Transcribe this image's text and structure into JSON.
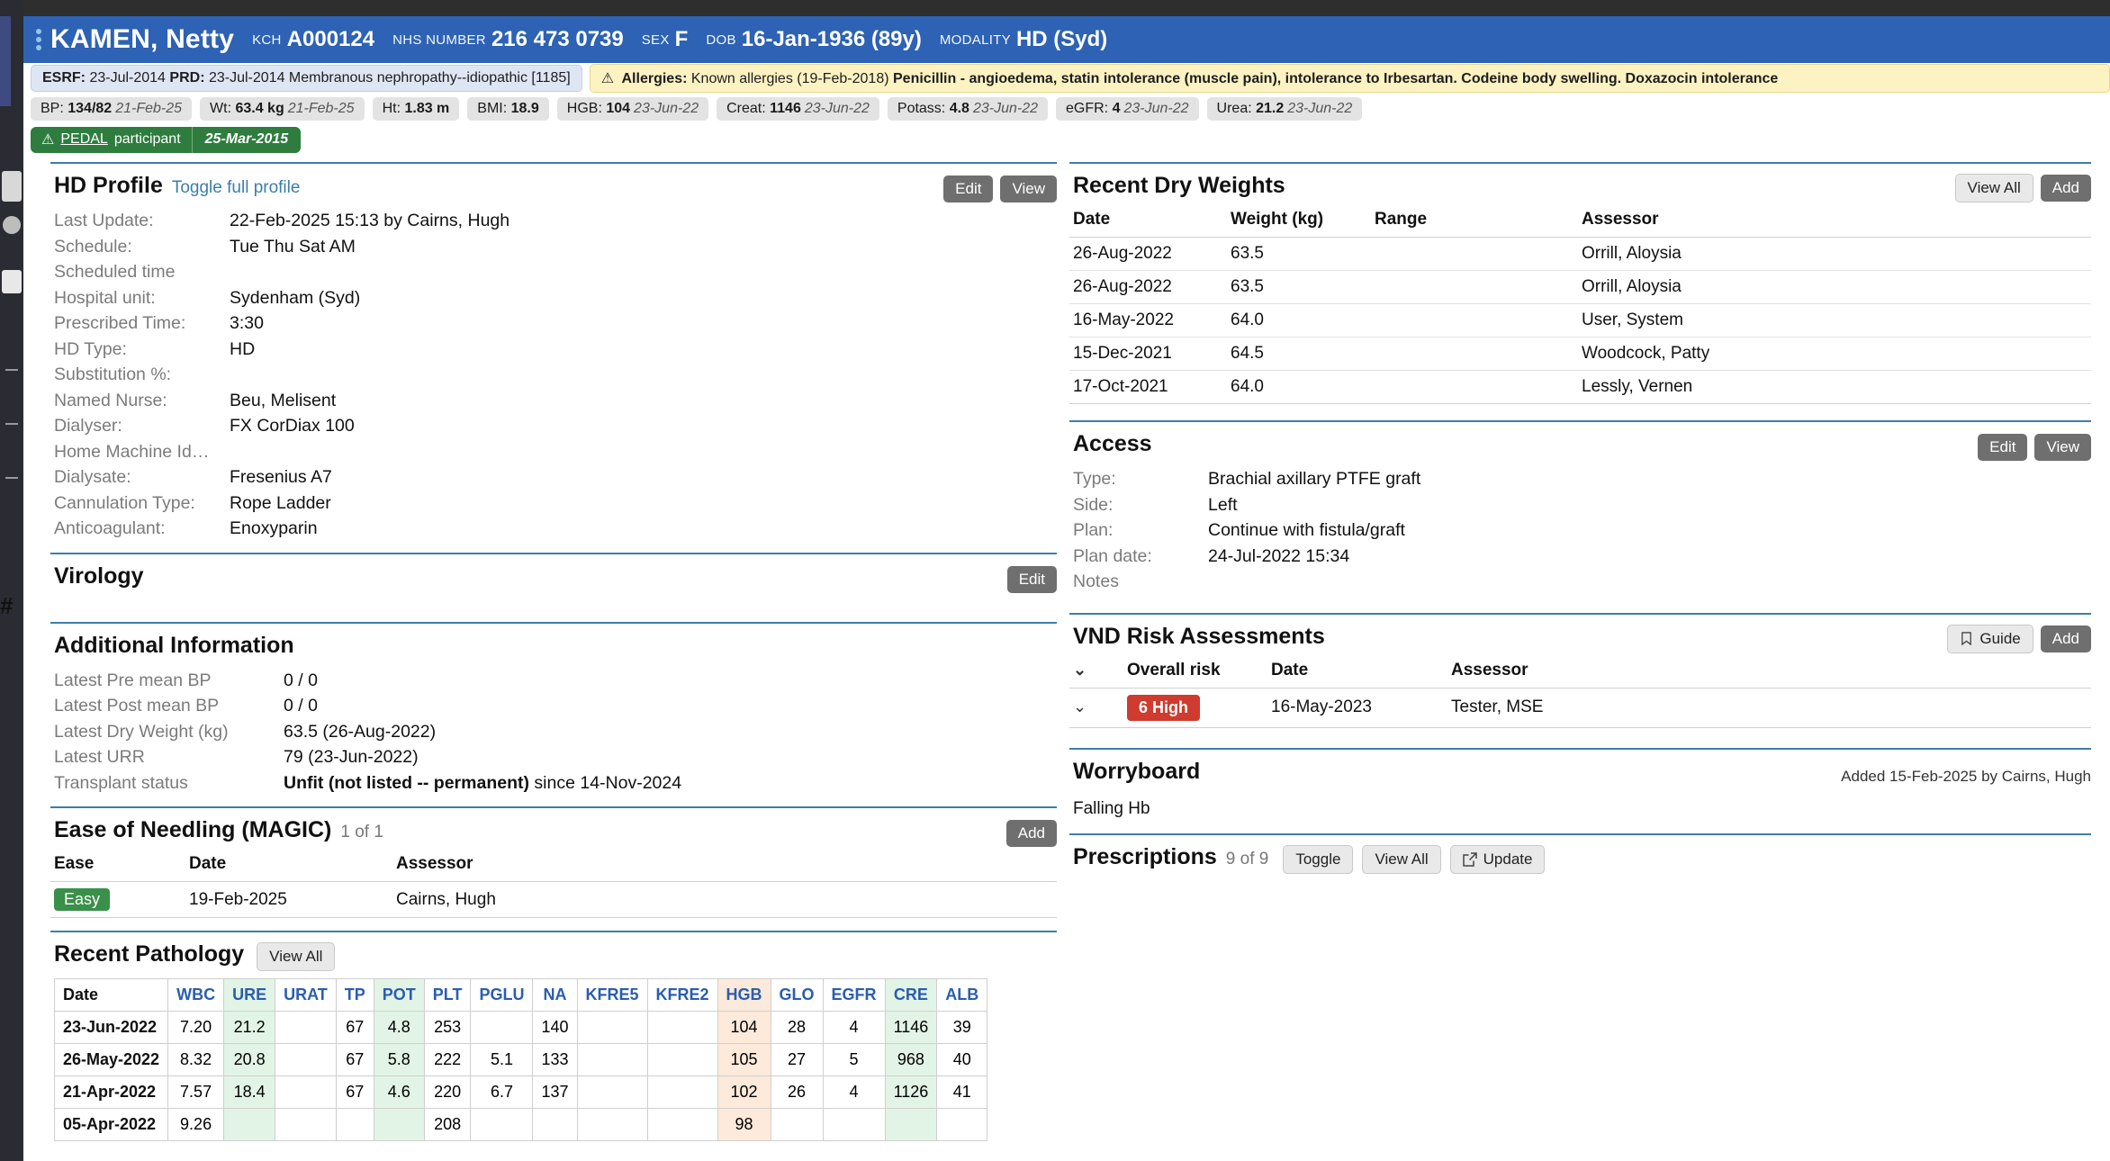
{
  "banner": {
    "patient_name": "KAMEN, Netty",
    "fields": [
      {
        "label": "KCH",
        "value": "A000124"
      },
      {
        "label": "NHS NUMBER",
        "value": "216 473 0739"
      },
      {
        "label": "SEX",
        "value": "F"
      },
      {
        "label": "DOB",
        "value": "16-Jan-1936 (89y)"
      },
      {
        "label": "MODALITY",
        "value": "HD (Syd)"
      }
    ]
  },
  "strips": {
    "esrf": "ESRF: 23-Jul-2014 PRD: 23-Jul-2014 Membranous nephropathy--idiopathic [1185]",
    "esrf_label1": "ESRF:",
    "esrf_val1": "23-Jul-2014",
    "esrf_label2": "PRD:",
    "esrf_val2": "23-Jul-2014 Membranous nephropathy--idiopathic [1185]",
    "allergies_label": "Allergies:",
    "allergies_known": "Known allergies (19-Feb-2018)",
    "allergies_detail": "Penicillin - angioedema, statin intolerance (muscle pain), intolerance to Irbesartan. Codeine body swelling. Doxazocin intolerance",
    "vitals": [
      {
        "key": "BP:",
        "value": "134/82",
        "date": "21-Feb-25"
      },
      {
        "key": "Wt:",
        "value": "63.4 kg",
        "date": "21-Feb-25"
      },
      {
        "key": "Ht:",
        "value": "1.83 m",
        "date": ""
      },
      {
        "key": "BMI:",
        "value": "18.9",
        "date": ""
      },
      {
        "key": "HGB:",
        "value": "104",
        "date": "23-Jun-22"
      },
      {
        "key": "Creat:",
        "value": "1146",
        "date": "23-Jun-22"
      },
      {
        "key": "Potass:",
        "value": "4.8",
        "date": "23-Jun-22"
      },
      {
        "key": "eGFR:",
        "value": "4",
        "date": "23-Jun-22"
      },
      {
        "key": "Urea:",
        "value": "21.2",
        "date": "23-Jun-22"
      }
    ],
    "pedal_label": "PEDAL",
    "pedal_word": "participant",
    "pedal_date": "25-Mar-2015"
  },
  "hd_profile": {
    "title": "HD Profile",
    "toggle_link": "Toggle full profile",
    "edit": "Edit",
    "view": "View",
    "rows": [
      {
        "key": "Last Update:",
        "value": "22-Feb-2025 15:13 by Cairns, Hugh"
      },
      {
        "key": "Schedule:",
        "value": "Tue Thu Sat AM"
      },
      {
        "key": "Scheduled time",
        "value": ""
      },
      {
        "key": "Hospital unit:",
        "value": "Sydenham (Syd)"
      },
      {
        "key": "Prescribed Time:",
        "value": "3:30"
      },
      {
        "key": "HD Type:",
        "value": "HD"
      },
      {
        "key": "Substitution %:",
        "value": ""
      },
      {
        "key": "Named Nurse:",
        "value": "Beu, Melisent"
      },
      {
        "key": "Dialyser:",
        "value": "FX CorDiax 100"
      },
      {
        "key": "Home Machine Id…",
        "value": ""
      },
      {
        "key": "Dialysate:",
        "value": "Fresenius A7"
      },
      {
        "key": "Cannulation Type:",
        "value": "Rope Ladder"
      },
      {
        "key": "Anticoagulant:",
        "value": "Enoxyparin"
      }
    ]
  },
  "virology": {
    "title": "Virology",
    "edit": "Edit"
  },
  "additional_info": {
    "title": "Additional Information",
    "rows": [
      {
        "key": "Latest Pre mean BP",
        "value": "0 / 0",
        "bold": ""
      },
      {
        "key": "Latest Post mean BP",
        "value": "0 / 0",
        "bold": ""
      },
      {
        "key": "Latest Dry Weight (kg)",
        "value": "63.5 (26-Aug-2022)",
        "bold": ""
      },
      {
        "key": "Latest URR",
        "value": "79  (23-Jun-2022)",
        "bold": ""
      },
      {
        "key": "Transplant status",
        "value": "Unfit (not listed -- permanent)",
        "bold": "since 14-Nov-2024"
      }
    ]
  },
  "ease_needling": {
    "title": "Ease of Needling (MAGIC)",
    "count": "1 of 1",
    "add": "Add",
    "columns": [
      "Ease",
      "Date",
      "Assessor"
    ],
    "rows": [
      {
        "ease": "Easy",
        "date": "19-Feb-2025",
        "assessor": "Cairns, Hugh"
      }
    ]
  },
  "recent_pathology": {
    "title": "Recent Pathology",
    "view_all": "View All",
    "columns": [
      "Date",
      "WBC",
      "URE",
      "URAT",
      "TP",
      "POT",
      "PLT",
      "PGLU",
      "NA",
      "KFRE5",
      "KFRE2",
      "HGB",
      "GLO",
      "EGFR",
      "CRE",
      "ALB"
    ],
    "highlight": {
      "URE": "green",
      "POT": "green",
      "HGB": "peach",
      "CRE": "green",
      "EGFR": "",
      "GLO": ""
    },
    "rows": [
      {
        "Date": "23-Jun-2022",
        "WBC": "7.20",
        "URE": "21.2",
        "URAT": "",
        "TP": "67",
        "POT": "4.8",
        "PLT": "253",
        "PGLU": "",
        "NA": "140",
        "KFRE5": "",
        "KFRE2": "",
        "HGB": "104",
        "GLO": "28",
        "EGFR": "4",
        "CRE": "1146",
        "ALB": "39"
      },
      {
        "Date": "26-May-2022",
        "WBC": "8.32",
        "URE": "20.8",
        "URAT": "",
        "TP": "67",
        "POT": "5.8",
        "PLT": "222",
        "PGLU": "5.1",
        "NA": "133",
        "KFRE5": "",
        "KFRE2": "",
        "HGB": "105",
        "GLO": "27",
        "EGFR": "5",
        "CRE": "968",
        "ALB": "40"
      },
      {
        "Date": "21-Apr-2022",
        "WBC": "7.57",
        "URE": "18.4",
        "URAT": "",
        "TP": "67",
        "POT": "4.6",
        "PLT": "220",
        "PGLU": "6.7",
        "NA": "137",
        "KFRE5": "",
        "KFRE2": "",
        "HGB": "102",
        "GLO": "26",
        "EGFR": "4",
        "CRE": "1126",
        "ALB": "41"
      },
      {
        "Date": "05-Apr-2022",
        "WBC": "9.26",
        "URE": "",
        "URAT": "",
        "TP": "",
        "POT": "",
        "PLT": "208",
        "PGLU": "",
        "NA": "",
        "KFRE5": "",
        "KFRE2": "",
        "HGB": "98",
        "GLO": "",
        "EGFR": "",
        "CRE": "",
        "ALB": ""
      }
    ]
  },
  "dry_weights": {
    "title": "Recent Dry Weights",
    "view_all": "View All",
    "add": "Add",
    "columns": [
      "Date",
      "Weight (kg)",
      "Range",
      "Assessor"
    ],
    "rows": [
      {
        "date": "26-Aug-2022",
        "weight": "63.5",
        "range": "",
        "assessor": "Orrill, Aloysia"
      },
      {
        "date": "26-Aug-2022",
        "weight": "63.5",
        "range": "",
        "assessor": "Orrill, Aloysia"
      },
      {
        "date": "16-May-2022",
        "weight": "64.0",
        "range": "",
        "assessor": "User, System"
      },
      {
        "date": "15-Dec-2021",
        "weight": "64.5",
        "range": "",
        "assessor": "Woodcock, Patty"
      },
      {
        "date": "17-Oct-2021",
        "weight": "64.0",
        "range": "",
        "assessor": "Lessly, Vernen"
      }
    ]
  },
  "access": {
    "title": "Access",
    "edit": "Edit",
    "view": "View",
    "rows": [
      {
        "key": "Type:",
        "value": "Brachial axillary PTFE graft"
      },
      {
        "key": "Side:",
        "value": "Left"
      },
      {
        "key": "Plan:",
        "value": "Continue with fistula/graft"
      },
      {
        "key": "Plan date:",
        "value": "24-Jul-2022 15:34"
      },
      {
        "key": "Notes",
        "value": ""
      }
    ]
  },
  "vnd": {
    "title": "VND Risk Assessments",
    "guide": "Guide",
    "add": "Add",
    "columns": [
      "",
      "Overall risk",
      "Date",
      "Assessor"
    ],
    "rows": [
      {
        "risk": "6 High",
        "date": "16-May-2023",
        "assessor": "Tester, MSE"
      }
    ]
  },
  "worryboard": {
    "title": "Worryboard",
    "meta": "Added 15-Feb-2025 by Cairns, Hugh",
    "text": "Falling Hb"
  },
  "prescriptions": {
    "title": "Prescriptions",
    "count": "9 of 9",
    "toggle": "Toggle",
    "view_all": "View All",
    "update": "Update"
  },
  "colors": {
    "banner_blue": "#2d62b4",
    "rule_blue": "#3d7ea6",
    "link_blue": "#3d7ea6",
    "green_badge": "#3a8f4a",
    "red_badge": "#cf3b2e",
    "allergy_yellow": "#fdf3c2"
  }
}
